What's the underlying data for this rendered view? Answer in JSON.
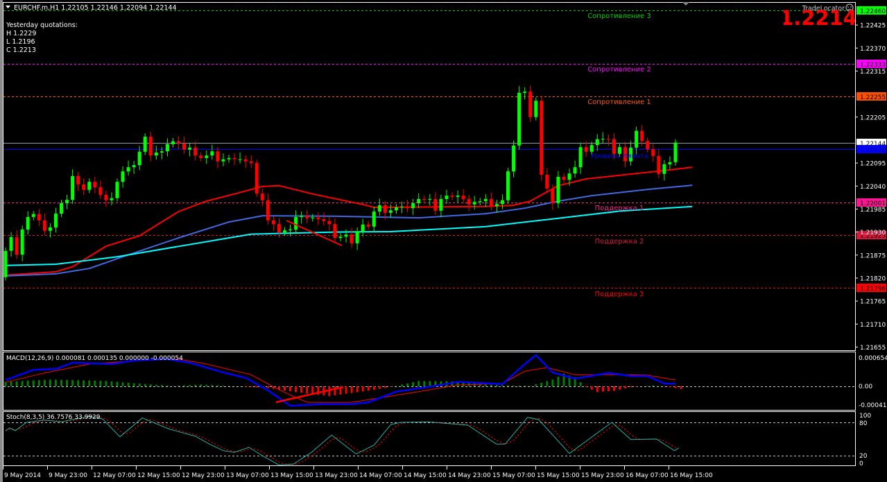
{
  "header": {
    "symbol_line": "EURCHF.m,H1  1.22105 1.22146 1.22094 1.22144",
    "yesterday_title": "Yesterday quotations:",
    "yesterday_high": "H 1.2229",
    "yesterday_low": "L 1.2196",
    "yesterday_close": "C 1.2213"
  },
  "trade_locator": {
    "label": "TradeLocator",
    "big_price": "1.2214",
    "icon": "sad-face-icon"
  },
  "colors": {
    "background": "#000000",
    "bull": "#00ff00",
    "bear": "#ff0000",
    "ma_fast": "#ff0000",
    "ma_mid": "#4169e1",
    "ma_slow": "#00ffff",
    "macd_main": "#0000ff",
    "macd_signal": "#ff0000",
    "stoch_main": "#20b2aa",
    "stoch_signal": "#ff0000"
  },
  "price_axis": {
    "labels": [
      "1.22425",
      "1.22370",
      "1.22315",
      "1.22205",
      "1.22095",
      "1.22040",
      "1.21985",
      "1.21930",
      "1.21875",
      "1.21820",
      "1.21765",
      "1.21710",
      "1.21655"
    ]
  },
  "levels": [
    {
      "key": "r3",
      "label": "Сопротивление 3",
      "price_text": "1.22460",
      "price": 1.2246,
      "color": "#00d000",
      "tag_bg": "#00ff00"
    },
    {
      "key": "r2",
      "label": "Сопротивление 2",
      "price_text": "1.22333",
      "price": 1.22333,
      "color": "#ff00ff",
      "tag_bg": "#ff00ff"
    },
    {
      "key": "r1",
      "label": "Сопротивление 1",
      "price_text": "1.22255",
      "price": 1.22255,
      "color": "#ff5a00",
      "tag_bg": "#ff5000"
    },
    {
      "key": "current",
      "label": "",
      "price_text": "1.22144",
      "price": 1.22144,
      "color": "#8a9aaa",
      "tag_bg": "#ffffff"
    },
    {
      "key": "pivot",
      "label": "Уровень пивота",
      "price_text": "1.22128",
      "price": 1.22128,
      "color": "#0000ff",
      "tag_bg": "#0000ff"
    },
    {
      "key": "s1",
      "label": "Поддержка 1",
      "price_text": "1.22001",
      "price": 1.22001,
      "color": "#ff1f8f",
      "tag_bg": "#ff1493"
    },
    {
      "key": "s2",
      "label": "Поддержка 2",
      "price_text": "1.21923",
      "price": 1.21923,
      "color": "#e0143c",
      "tag_bg": "#dc143c"
    },
    {
      "key": "s3",
      "label": "Поддержка 3",
      "price_text": "1.21796",
      "price": 1.21796,
      "color": "#ff0000",
      "tag_bg": "#ff0000"
    }
  ],
  "time_axis": {
    "labels": [
      "9 May 2014",
      "9 May 23:00",
      "12 May 07:00",
      "12 May 15:00",
      "12 May 23:00",
      "13 May 07:00",
      "13 May 15:00",
      "13 May 23:00",
      "14 May 07:00",
      "14 May 15:00",
      "14 May 23:00",
      "15 May 07:00",
      "15 May 15:00",
      "15 May 23:00",
      "16 May 07:00",
      "16 May 15:00"
    ]
  },
  "macd": {
    "title": "MACD(12,26,9) 0.000081 0.000135 0.000000 -0.000054",
    "axis_labels": [
      "0.000654",
      "0.00",
      "-0.000419"
    ]
  },
  "stoch": {
    "title": "Stoch(8,3,5) 36.7576 33.9929",
    "axis_labels": [
      "100",
      "80",
      "20",
      "0"
    ]
  },
  "chart_data": [
    {
      "type": "candlestick",
      "title": "EURCHF.m,H1",
      "first_open": 1.21822,
      "closes": [
        1.21885,
        1.21918,
        1.21876,
        1.21936,
        1.21966,
        1.21973,
        1.21958,
        1.21933,
        1.21941,
        1.21974,
        1.21999,
        1.22007,
        1.22064,
        1.22044,
        1.22031,
        1.2205,
        1.22037,
        1.22019,
        1.22006,
        1.22011,
        1.2205,
        1.22075,
        1.22085,
        1.2209,
        1.22122,
        1.22158,
        1.22113,
        1.2212,
        1.22123,
        1.2214,
        1.22147,
        1.22142,
        1.22127,
        1.22132,
        1.22113,
        1.22107,
        1.22113,
        1.22123,
        1.22099,
        1.22104,
        1.22107,
        1.22104,
        1.22104,
        1.22099,
        1.22095,
        1.22022,
        1.22006,
        1.21958,
        1.21949,
        1.21929,
        1.21934,
        1.21936,
        1.21966,
        1.21969,
        1.21963,
        1.21965,
        1.21961,
        1.21956,
        1.21949,
        1.21916,
        1.21919,
        1.21924,
        1.21903,
        1.21931,
        1.21948,
        1.21943,
        1.21979,
        1.21994,
        1.21976,
        1.21982,
        1.21989,
        1.21991,
        1.21987,
        1.21999,
        1.22009,
        1.22007,
        1.22009,
        1.21981,
        1.22009,
        1.22017,
        1.22014,
        1.22017,
        1.22009,
        1.21996,
        1.22002,
        1.22004,
        1.22009,
        1.21992,
        1.21997,
        1.22006,
        1.22075,
        1.22137,
        1.22263,
        1.22266,
        1.22205,
        1.22244,
        1.22067,
        1.22034,
        1.21999,
        1.22062,
        1.22055,
        1.2207,
        1.22085,
        1.22133,
        1.22122,
        1.22138,
        1.22152,
        1.22153,
        1.22152,
        1.22117,
        1.22133,
        1.22099,
        1.22132,
        1.22172,
        1.22148,
        1.22128,
        1.22112,
        1.22069,
        1.22092,
        1.22097,
        1.22144
      ],
      "ylim": [
        1.2164,
        1.2248
      ],
      "moving_averages": [
        {
          "name": "ma_fast",
          "points": [
            [
              0,
              1.21827
            ],
            [
              9,
              1.21835
            ],
            [
              12,
              1.21847
            ],
            [
              18,
              1.21896
            ],
            [
              24,
              1.21921
            ],
            [
              31,
              1.21979
            ],
            [
              36,
              1.22004
            ],
            [
              41,
              1.22021
            ],
            [
              46,
              1.22039
            ],
            [
              49,
              1.22041
            ],
            [
              55,
              1.22021
            ],
            [
              64,
              1.21996
            ],
            [
              66,
              1.21989
            ],
            [
              86,
              1.21991
            ],
            [
              91,
              1.21994
            ],
            [
              94,
              1.22004
            ],
            [
              99,
              1.22041
            ],
            [
              104,
              1.22057
            ],
            [
              118,
              1.22077
            ],
            [
              123,
              1.22085
            ]
          ]
        },
        {
          "name": "ma_mid",
          "points": [
            [
              0,
              1.21825
            ],
            [
              9,
              1.2183
            ],
            [
              15,
              1.21843
            ],
            [
              21,
              1.21871
            ],
            [
              31,
              1.21916
            ],
            [
              40,
              1.21954
            ],
            [
              46,
              1.21969
            ],
            [
              59,
              1.21968
            ],
            [
              74,
              1.21964
            ],
            [
              86,
              1.21974
            ],
            [
              93,
              1.21987
            ],
            [
              99,
              1.22004
            ],
            [
              105,
              1.22017
            ],
            [
              115,
              1.22032
            ],
            [
              123,
              1.22042
            ]
          ]
        },
        {
          "name": "ma_slow",
          "points": [
            [
              0,
              1.2185
            ],
            [
              9,
              1.21853
            ],
            [
              20,
              1.21871
            ],
            [
              44,
              1.21925
            ],
            [
              59,
              1.2193
            ],
            [
              69,
              1.21931
            ],
            [
              86,
              1.21943
            ],
            [
              99,
              1.21963
            ],
            [
              110,
              1.2198
            ],
            [
              123,
              1.21991
            ]
          ]
        }
      ]
    },
    {
      "type": "line",
      "title": "MACD(12,26,9)",
      "ylim": [
        -0.000419,
        0.000654
      ],
      "main": [
        [
          0,
          0.00014
        ],
        [
          5,
          0.00037
        ],
        [
          9,
          0.00039
        ],
        [
          12,
          0.00053
        ],
        [
          19,
          0.0005
        ],
        [
          23,
          0.00058
        ],
        [
          29,
          0.00061
        ],
        [
          33,
          0.00053
        ],
        [
          39,
          0.00031
        ],
        [
          43,
          0.00019
        ],
        [
          47,
          -9e-05
        ],
        [
          51,
          -0.00044
        ],
        [
          56,
          -0.0004
        ],
        [
          62,
          -0.0004
        ],
        [
          65,
          -0.00036
        ],
        [
          70,
          -0.00012
        ],
        [
          78,
          3e-05
        ],
        [
          81,
          0.0001
        ],
        [
          89,
          5e-05
        ],
        [
          93,
          0.0005
        ],
        [
          95,
          0.0007
        ],
        [
          98,
          0.00031
        ],
        [
          102,
          0.00017
        ],
        [
          108,
          0.0003
        ],
        [
          112,
          0.00023
        ],
        [
          115,
          0.00023
        ],
        [
          118,
          6e-05
        ],
        [
          120,
          6e-05
        ]
      ],
      "signal": [
        [
          0,
          9e-05
        ],
        [
          7,
          0.0003
        ],
        [
          15,
          0.0005
        ],
        [
          25,
          0.00059
        ],
        [
          31,
          0.00061
        ],
        [
          36,
          0.0005
        ],
        [
          44,
          0.00026
        ],
        [
          49,
          -8e-05
        ],
        [
          54,
          -0.00036
        ],
        [
          62,
          -0.00036
        ],
        [
          74,
          -0.00012
        ],
        [
          81,
          3e-05
        ],
        [
          89,
          6e-05
        ],
        [
          93,
          0.00034
        ],
        [
          97,
          0.00042
        ],
        [
          102,
          0.00026
        ],
        [
          111,
          0.00026
        ],
        [
          115,
          0.00025
        ],
        [
          120,
          0.00014
        ]
      ],
      "histogram": [
        [
          0,
          0.0001
        ],
        [
          8,
          0.00015
        ],
        [
          18,
          0.00012
        ],
        [
          25,
          5e-05
        ],
        [
          30,
          1e-05
        ],
        [
          35,
          4e-05
        ],
        [
          40,
          1e-05
        ],
        [
          47,
          -4e-05
        ],
        [
          52,
          -0.00013
        ],
        [
          58,
          -0.00022
        ],
        [
          62,
          -0.00015
        ],
        [
          66,
          -8e-05
        ],
        [
          70,
          1e-05
        ],
        [
          74,
          0.00012
        ],
        [
          80,
          0.00011
        ],
        [
          86,
          4e-05
        ],
        [
          90,
          2e-05
        ],
        [
          94,
          1e-05
        ],
        [
          98,
          0.00015
        ],
        [
          100,
          0.00028
        ],
        [
          102,
          0.0002
        ],
        [
          104,
          -2e-05
        ],
        [
          106,
          -0.00013
        ],
        [
          109,
          -0.0001
        ],
        [
          112,
          -2e-05
        ],
        [
          116,
          2e-05
        ],
        [
          119,
          -2e-05
        ],
        [
          121,
          -6e-05
        ]
      ]
    },
    {
      "type": "line",
      "title": "Stoch(8,3,5)",
      "ylim": [
        0,
        100
      ],
      "levels": [
        20,
        80
      ],
      "main": [
        [
          0,
          65
        ],
        [
          0.75,
          70
        ],
        [
          1.75,
          65
        ],
        [
          3.75,
          80
        ],
        [
          7,
          84
        ],
        [
          10,
          81
        ],
        [
          15,
          91
        ],
        [
          17.4,
          86
        ],
        [
          20.5,
          54
        ],
        [
          24.5,
          88
        ],
        [
          29.3,
          68
        ],
        [
          34,
          55
        ],
        [
          36.5,
          41
        ],
        [
          39,
          29
        ],
        [
          41,
          26
        ],
        [
          43.6,
          35
        ],
        [
          46,
          20
        ],
        [
          49,
          3
        ],
        [
          51.6,
          5
        ],
        [
          54.8,
          26
        ],
        [
          58.4,
          57
        ],
        [
          62.8,
          23
        ],
        [
          66,
          39
        ],
        [
          69,
          76
        ],
        [
          70.8,
          80
        ],
        [
          75.5,
          81
        ],
        [
          82.8,
          75
        ],
        [
          87.9,
          41
        ],
        [
          89.5,
          41
        ],
        [
          93.5,
          89
        ],
        [
          95.5,
          85
        ],
        [
          101,
          24
        ],
        [
          108.6,
          80
        ],
        [
          112,
          49
        ],
        [
          116.6,
          50
        ],
        [
          119.8,
          29
        ],
        [
          120.6,
          34
        ]
      ]
    }
  ]
}
